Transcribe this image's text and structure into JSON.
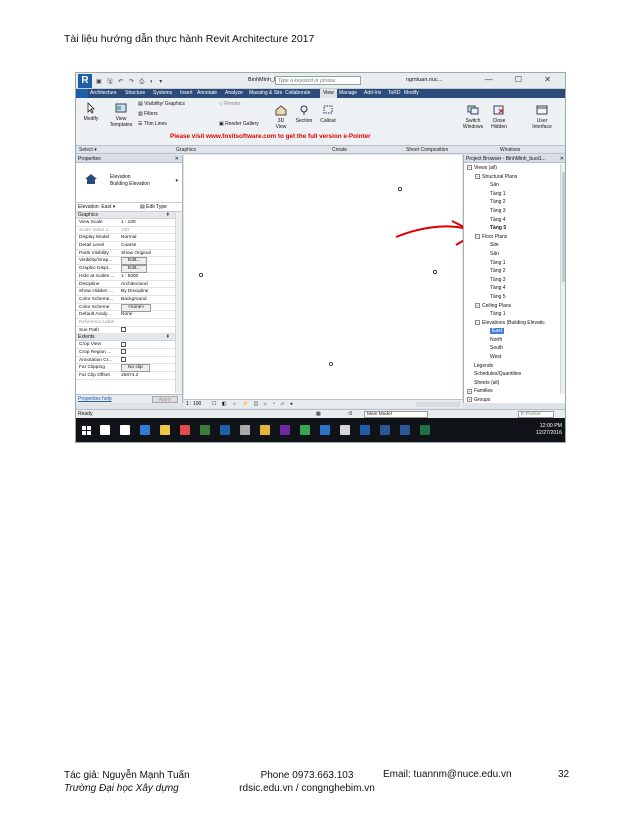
{
  "page": {
    "header": "Tài liệu hướng dẫn thực hành Revit Architecture 2017",
    "author": "Tác giả: Nguyễn Mạnh Tuấn",
    "school": "Trường Đại học Xây dựng",
    "phone": "Phone 0973.663.103",
    "website": "rdsic.edu.vn / congnghebim.vn",
    "email": "Email: tuannm@nuce.edu.vn",
    "page_number": "32"
  },
  "titlebar": {
    "logo": "R",
    "doc_title": "BinhMinh_buoi1...",
    "search_placeholder": "Type a keyword or phrase",
    "user": "ngmtuan.nuc...",
    "controls": "— ☐ ✕"
  },
  "tabs": [
    "Architecture",
    "Structure",
    "Systems",
    "Insert",
    "Annotate",
    "Analyze",
    "Massing & Site",
    "Collaborate",
    "View",
    "Manage",
    "Add-Ins",
    "ToRD",
    "Modify"
  ],
  "active_tab": "View",
  "ribbon": {
    "modify": "Modify",
    "view_templates": "View Templates",
    "visibility": "Visibility/ Graphics",
    "filters": "Filters",
    "thin_lines": "Thin Lines",
    "render": "Render",
    "render_gallery": "Render Gallery",
    "view_3d": "3D View",
    "section": "Section",
    "callout": "Callout",
    "switch_windows": "Switch Windows",
    "close_hidden": "Close Hidden",
    "user_interface": "User Interface",
    "promo": "Please visit www.foxitsoftware.com to get the full version e-Pointer"
  },
  "panels": {
    "select": "Select ▾",
    "graphics": "Graphics",
    "create": "Create",
    "sheet_composition": "Sheet Composition",
    "windows": "Windows"
  },
  "properties": {
    "title": "Properties",
    "close": "✕",
    "type_line1": "Elevation",
    "type_line2": "Building Elevation",
    "instance": "Elevation: East",
    "edit_type": "Edit Type",
    "groups": {
      "graphics": "Graphics",
      "extents": "Extents"
    },
    "graphics_rows": [
      {
        "k": "View Scale",
        "v": "1 : 100"
      },
      {
        "k": "Scale Value    1:",
        "v": "100"
      },
      {
        "k": "Display Model",
        "v": "Normal"
      },
      {
        "k": "Detail Level",
        "v": "Coarse"
      },
      {
        "k": "Parts Visibility",
        "v": "Show Original"
      },
      {
        "k": "Visibility/Grap...",
        "v": "Edit..."
      },
      {
        "k": "Graphic Displ...",
        "v": "Edit..."
      },
      {
        "k": "Hide at scales ...",
        "v": "1 : 5000"
      },
      {
        "k": "Discipline",
        "v": "Architectural"
      },
      {
        "k": "Show Hidden ...",
        "v": "By Discipline"
      },
      {
        "k": "Color Scheme...",
        "v": "Background"
      },
      {
        "k": "Color Scheme",
        "v": "<none>"
      },
      {
        "k": "Default Analy...",
        "v": "None"
      },
      {
        "k": "Reference Label",
        "v": ""
      },
      {
        "k": "Sun Path",
        "v": ""
      }
    ],
    "extents_rows": [
      {
        "k": "Crop View",
        "v": ""
      },
      {
        "k": "Crop Region ...",
        "v": ""
      },
      {
        "k": "Annotation Cr...",
        "v": ""
      },
      {
        "k": "Far Clipping",
        "v": "No clip"
      },
      {
        "k": "Far Clip Offset",
        "v": "26874.2"
      }
    ],
    "help": "Properties help",
    "apply": "Apply"
  },
  "browser": {
    "title": "Project Browser - BinhMinh_buoi1...",
    "close": "✕",
    "items": [
      {
        "label": "Views (all)",
        "level": 0,
        "pm": "−"
      },
      {
        "label": "Structural Plans",
        "level": 1,
        "pm": "−"
      },
      {
        "label": "Sân",
        "level": 2
      },
      {
        "label": "Tầng 1",
        "level": 2
      },
      {
        "label": "Tầng 2",
        "level": 2
      },
      {
        "label": "Tầng 3",
        "level": 2
      },
      {
        "label": "Tầng 4",
        "level": 2
      },
      {
        "label": "Tầng 5",
        "level": 2,
        "bold": true
      },
      {
        "label": "Floor Plans",
        "level": 1,
        "pm": "−"
      },
      {
        "label": "Site",
        "level": 2
      },
      {
        "label": "Sân",
        "level": 2
      },
      {
        "label": "Tầng 1",
        "level": 2
      },
      {
        "label": "Tầng 2",
        "level": 2
      },
      {
        "label": "Tầng 3",
        "level": 2
      },
      {
        "label": "Tầng 4",
        "level": 2
      },
      {
        "label": "Tầng 5",
        "level": 2
      },
      {
        "label": "Ceiling Plans",
        "level": 1,
        "pm": "−"
      },
      {
        "label": "Tầng 1",
        "level": 2
      },
      {
        "label": "Elevations (Building Elevatic",
        "level": 1,
        "pm": "−"
      },
      {
        "label": "East",
        "level": 2,
        "selected": true
      },
      {
        "label": "North",
        "level": 2
      },
      {
        "label": "South",
        "level": 2
      },
      {
        "label": "West",
        "level": 2
      },
      {
        "label": "Legends",
        "level": 0
      },
      {
        "label": "Schedules/Quantities",
        "level": 0
      },
      {
        "label": "Sheets (all)",
        "level": 0
      },
      {
        "label": "Families",
        "level": 0,
        "pm": "+"
      },
      {
        "label": "Groups",
        "level": 0,
        "pm": "+"
      }
    ]
  },
  "view_controls": {
    "scale": "1 : 100"
  },
  "status": {
    "ready": "Ready",
    "model": "Main Model",
    "epointer": "E-Pointer",
    "coord": ":0"
  },
  "taskbar": {
    "time": "12:00 PM",
    "date": "12/27/2016"
  },
  "colors": {
    "revit_blue": "#1f5fa8",
    "tab_bar": "#2b4c7a",
    "annotation_red": "#e00000",
    "selection": "#3f7ed8",
    "taskbar": "#101418"
  }
}
